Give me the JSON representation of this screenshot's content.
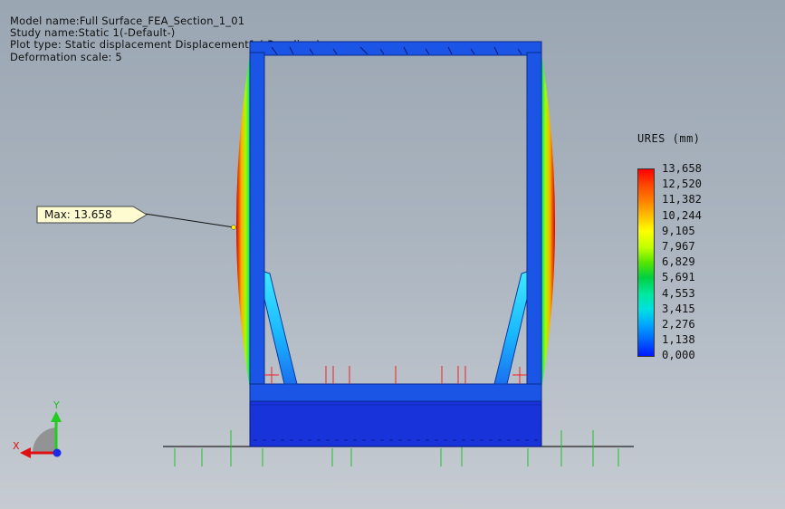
{
  "info": {
    "model_name": "Model name:Full Surface_FEA_Section_1_01",
    "study_name": "Study name:Static 1(-Default-)",
    "plot_type": "Plot type: Static displacement Displacement1 (-Res disp-)",
    "deformation_scale": "Deformation scale: 5"
  },
  "legend": {
    "title": "URES (mm)",
    "values": [
      "13,658",
      "12,520",
      "11,382",
      "10,244",
      "9,105",
      "7,967",
      "6,829",
      "5,691",
      "4,553",
      "3,415",
      "2,276",
      "1,138",
      "0,000"
    ]
  },
  "callout": {
    "label": "Max: 13.658"
  },
  "triad": {
    "x_label": "X",
    "y_label": "Y"
  },
  "colors": {
    "structure_blue": "#1a55e6",
    "base_blue": "#1733d9",
    "max_red": "#e8221a",
    "fixture_green": "#22c02a",
    "load_red": "#ee2222"
  }
}
